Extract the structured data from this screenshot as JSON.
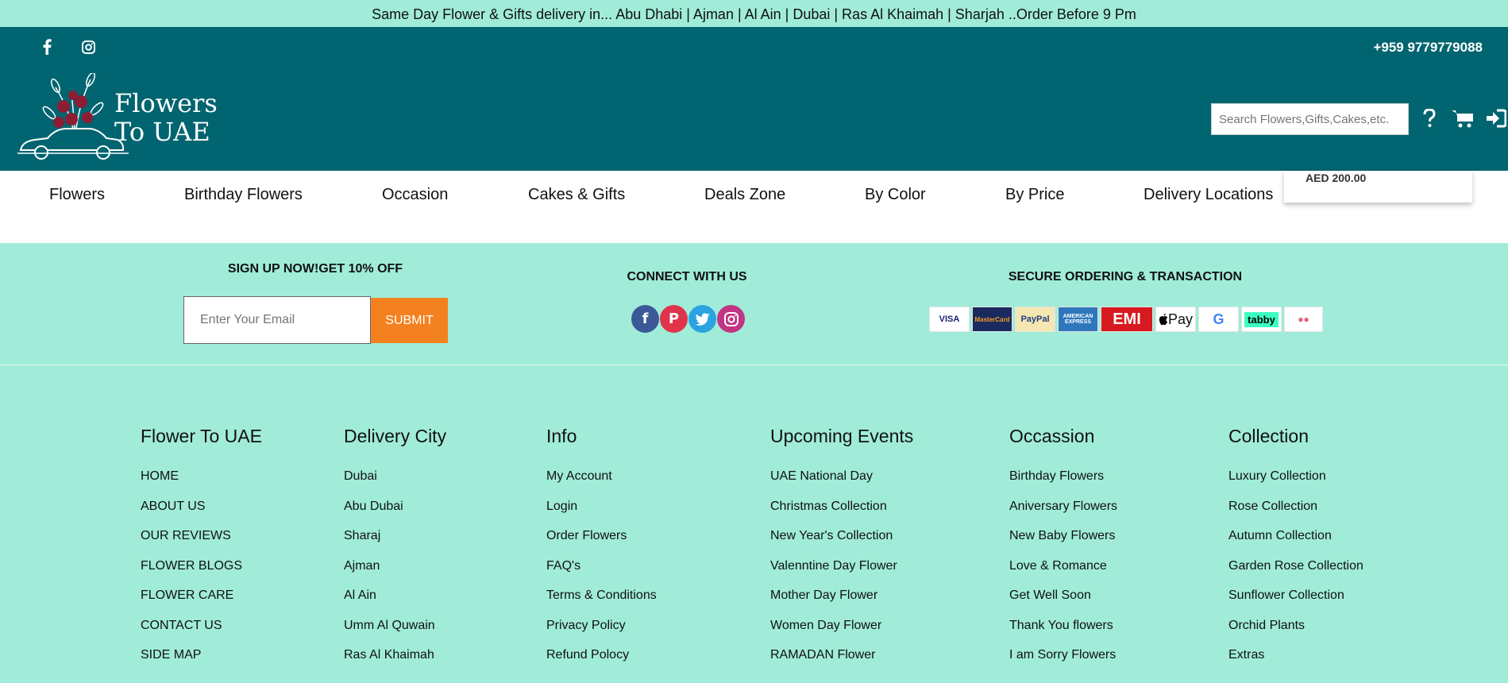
{
  "announcement": "Same Day Flower & Gifts delivery in... Abu Dhabi | Ajman | Al Ain | Dubai | Ras Al Khaimah | Sharjah ..Order Before 9 Pm",
  "header": {
    "phone": "+959 9779779088",
    "logo": {
      "line1": "Flowers",
      "line2": "To UAE"
    },
    "search_placeholder": "Search Flowers,Gifts,Cakes,etc.",
    "social_icons": [
      "facebook-icon",
      "instagram-icon"
    ],
    "action_icons": [
      "help-icon",
      "cart-icon",
      "login-icon"
    ]
  },
  "nav": {
    "items": [
      "Flowers",
      "Birthday Flowers",
      "Occasion",
      "Cakes & Gifts",
      "Deals Zone",
      "By Color",
      "By Price",
      "Delivery Locations"
    ],
    "ghost_prices": [
      "AED 200.00"
    ]
  },
  "newsletter": {
    "title": "SIGN UP NOW!GET 10% OFF",
    "email_placeholder": "Enter Your Email",
    "submit_label": "SUBMIT"
  },
  "connect": {
    "title": "CONNECT WITH US",
    "icons": [
      "facebook-icon",
      "pinterest-icon",
      "twitter-icon",
      "instagram-icon"
    ]
  },
  "secure": {
    "title": "SECURE ORDERING & TRANSACTION",
    "badges": [
      "VISA",
      "MasterCard",
      "PayPal",
      "AMERICAN EXPRESS",
      "EMI",
      "Pay",
      "G",
      "tabby",
      "●●"
    ]
  },
  "footer": {
    "columns": [
      {
        "title": "Flower To UAE",
        "links": [
          "HOME",
          "ABOUT US",
          "OUR REVIEWS",
          "FLOWER BLOGS",
          "FLOWER CARE",
          "CONTACT US",
          "SIDE MAP"
        ]
      },
      {
        "title": "Delivery City",
        "links": [
          "Dubai",
          "Abu Dubai",
          "Sharaj",
          "Ajman",
          "Al Ain",
          "Umm Al Quwain",
          "Ras Al Khaimah"
        ]
      },
      {
        "title": "Info",
        "links": [
          "My Account",
          "Login",
          "Order Flowers",
          "FAQ's",
          "Terms & Conditions",
          "Privacy Policy",
          "Refund Polocy"
        ]
      },
      {
        "title": "Upcoming Events",
        "links": [
          "UAE National Day",
          "Christmas Collection",
          "New Year's Collection",
          "Valenntine Day Flower",
          "Mother Day Flower",
          "Women Day Flower",
          "RAMADAN Flower"
        ]
      },
      {
        "title": "Occassion",
        "links": [
          "Birthday Flowers",
          "Aniversary Flowers",
          "New Baby Flowers",
          "Love & Romance",
          "Get Well Soon",
          "Thank You flowers",
          "I am Sorry Flowers"
        ]
      },
      {
        "title": "Collection",
        "links": [
          "Luxury Collection",
          "Rose Collection",
          "Autumn Collection",
          "Garden Rose Collection",
          "Sunflower Collection",
          "Orchid Plants",
          "Extras"
        ]
      }
    ]
  },
  "colors": {
    "header_bg": "#006570",
    "page_bg": "#a0ecd8",
    "submit_bg": "#f48120"
  }
}
